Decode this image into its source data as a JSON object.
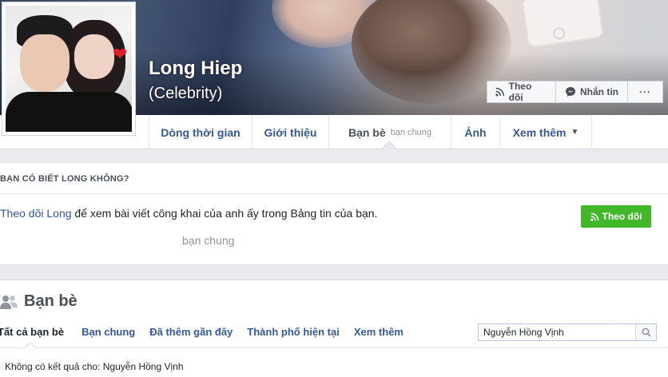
{
  "profile": {
    "name": "Long Hiep",
    "subtitle": "(Celebrity)"
  },
  "cover_actions": {
    "follow": "Theo dõi",
    "message": "Nhắn tin",
    "more": "···"
  },
  "nav": {
    "tabs": [
      {
        "label": "Dòng thời gian"
      },
      {
        "label": "Giới thiệu"
      },
      {
        "label": "Bạn bè",
        "sub": "bạn chung"
      },
      {
        "label": "Ảnh"
      },
      {
        "label": "Xem thêm"
      }
    ]
  },
  "suggest_card": {
    "title": "BẠN CÓ BIẾT LONG KHÔNG?",
    "link_text": "Theo dõi Long",
    "rest_text": " để xem bài viết công khai của anh ấy trong Bảng tin của bạn.",
    "mutual": "bạn chung",
    "follow_button": "Theo dõi"
  },
  "friends": {
    "title": "Bạn bè",
    "tabs": [
      "Tất cả bạn bè",
      "Bạn chung",
      "Đã thêm gần đây",
      "Thành phố hiện tại",
      "Xem thêm"
    ],
    "search_value": "Nguyễn Hồng Vịnh",
    "no_result": "Không có kết quả cho: Nguyễn Hồng Vịnh"
  },
  "colors": {
    "link": "#365899",
    "green": "#42b72a",
    "background": "#e9ebee"
  }
}
